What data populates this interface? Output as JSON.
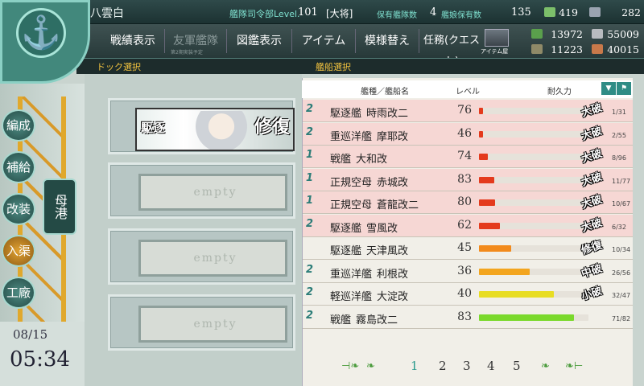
{
  "header": {
    "admiral_name": "八雲白",
    "hq_level_label": "艦隊司令部Level.",
    "hq_level": "101",
    "rank": "[大将]",
    "fleet_count_label": "保有艦隊数",
    "fleet_count": "4",
    "ship_count_label": "艦娘保有数",
    "ship_count": "135"
  },
  "resources": {
    "bucket": "419",
    "devmat": "282",
    "fuel": "13972",
    "ammo": "11223",
    "steel": "55009",
    "bauxite": "40015"
  },
  "menu": {
    "items": [
      "戦績表示",
      "友軍艦隊",
      "図鑑表示",
      "アイテム",
      "模様替え",
      "任務(クエスト)"
    ],
    "item2_sub": "第2期実装予定",
    "shop_label": "アイテム屋"
  },
  "subheader": {
    "dock_select": "ドック選択",
    "ship_select": "艦船選択"
  },
  "side": {
    "buttons": [
      "編成",
      "補給",
      "改装",
      "入渠",
      "工廠"
    ],
    "supply_tab": "母港",
    "date": "08/15",
    "time": "05:34"
  },
  "docks": {
    "banner_label": "駆逐",
    "banner_status": "修復",
    "empty_label": "empty"
  },
  "list": {
    "col_type_name": "艦種／艦船名",
    "col_level": "レベル",
    "col_hp": "耐久力",
    "rows": [
      {
        "fleet": "2",
        "type": "駆逐艦",
        "name": "時雨改二",
        "level": "76",
        "hp": "1/31",
        "damage": "大破"
      },
      {
        "fleet": "2",
        "type": "重巡洋艦",
        "name": "摩耶改",
        "level": "46",
        "hp": "2/55",
        "damage": "大破"
      },
      {
        "fleet": "1",
        "type": "戦艦",
        "name": "大和改",
        "level": "74",
        "hp": "8/96",
        "damage": "大破"
      },
      {
        "fleet": "1",
        "type": "正規空母",
        "name": "赤城改",
        "level": "83",
        "hp": "11/77",
        "damage": "大破"
      },
      {
        "fleet": "1",
        "type": "正規空母",
        "name": "蒼龍改二",
        "level": "80",
        "hp": "10/67",
        "damage": "大破"
      },
      {
        "fleet": "2",
        "type": "駆逐艦",
        "name": "雪風改",
        "level": "62",
        "hp": "6/32",
        "damage": "大破"
      },
      {
        "fleet": "",
        "type": "駆逐艦",
        "name": "天津風改",
        "level": "45",
        "hp": "10/34",
        "damage": "修復"
      },
      {
        "fleet": "2",
        "type": "重巡洋艦",
        "name": "利根改",
        "level": "36",
        "hp": "26/56",
        "damage": "中破"
      },
      {
        "fleet": "2",
        "type": "軽巡洋艦",
        "name": "大淀改",
        "level": "40",
        "hp": "32/47",
        "damage": "小破"
      },
      {
        "fleet": "2",
        "type": "戦艦",
        "name": "霧島改二",
        "level": "83",
        "hp": "71/82",
        "damage": ""
      }
    ],
    "hp_fraction": [
      0.032,
      0.036,
      0.083,
      0.143,
      0.149,
      0.188,
      0.294,
      0.464,
      0.681,
      0.866
    ],
    "hp_colors": [
      "#e43a1d",
      "#e43a1d",
      "#e43a1d",
      "#e43a1d",
      "#e43a1d",
      "#e43a1d",
      "#f28a1c",
      "#f3a51e",
      "#e8dd22",
      "#7ad92c"
    ],
    "row_colors": [
      "#f6d7d4",
      "#f6d7d4",
      "#f6d7d4",
      "#f6d7d4",
      "#f6d7d4",
      "#f6d7d4",
      "#f1efe8",
      "#f1efe8",
      "#f1efe8",
      "#f1efe8"
    ]
  },
  "pagination": {
    "pages": [
      "1",
      "2",
      "3",
      "4",
      "5"
    ],
    "current": "1"
  }
}
